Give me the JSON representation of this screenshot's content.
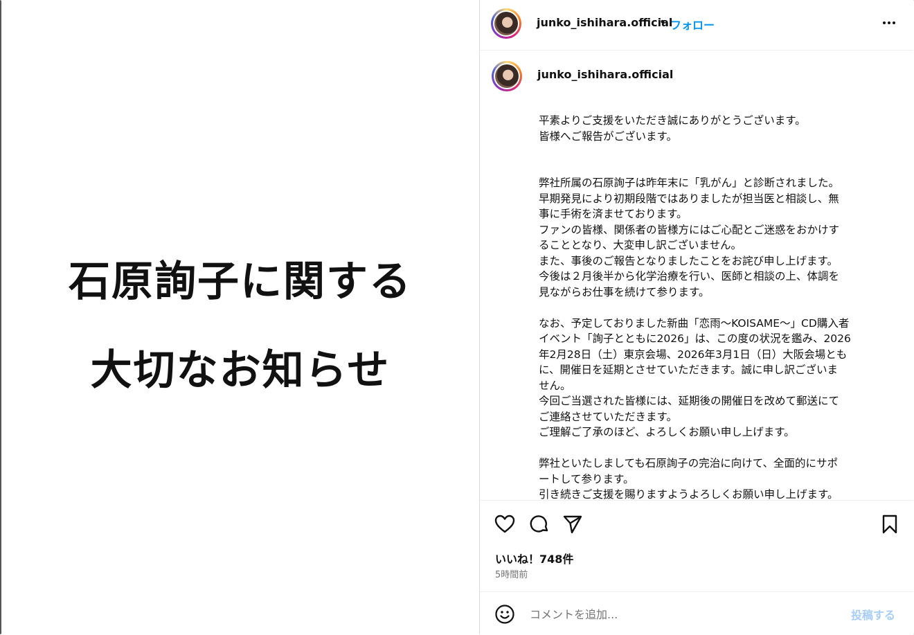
{
  "image": {
    "line1": "石原詢子に関する",
    "line2": "大切なお知らせ"
  },
  "header": {
    "username": "junko_ishihara.official",
    "separator": "•",
    "follow_label": "フォロー",
    "more_icon": "more-horizontal-icon"
  },
  "caption": {
    "username": "junko_ishihara.official",
    "text": "平素よりご支援をいただき誠にありがとうございます。\n皆様へご報告がございます。\n\n\n弊社所属の石原詢子は昨年末に「乳がん」と診断されました。\n早期発見により初期段階ではありましたが担当医と相談し、無\n事に手術を済ませております。\nファンの皆様、関係者の皆様方にはご心配とご迷惑をおかけす\nることとなり、大変申し訳ございません。\nまた、事後のご報告となりましたことをお詫び申し上げます。\n今後は２月後半から化学治療を行い、医師と相談の上、体調を\n見ながらお仕事を続けて参ります。\n\nなお、予定しておりました新曲「恋雨〜KOISAME〜」CD購入者\nイベント「詢子とともに2026」は、この度の状況を鑑み、2026\n年2月28日（土）東京会場、2026年3月1日（日）大阪会場とも\nに、開催日を延期とさせていただきます。誠に申し訳ございま\nせん。\n今回ご当選された皆様には、延期後の開催日を改めて郵送にて\nご連絡させていただきます。\nご理解ご了承のほど、よろしくお願い申し上げます。\n\n弊社といたしましても石原詢子の完治に向けて、全面的にサポ\nートして参ります。\n引き続きご支援を賜りますようよろしくお願い申し上げます。"
  },
  "actions": {
    "icons": [
      "heart-icon",
      "comment-icon",
      "share-icon",
      "bookmark-icon"
    ],
    "likes_label": "いいね！748件",
    "time_label": "5時間前"
  },
  "comment": {
    "placeholder": "コメントを追加...",
    "post_label": "投稿する",
    "post_color": "#a7cdfa"
  },
  "colors": {
    "accent": "#0095f6",
    "muted": "#737373",
    "border": "#dbdbdb"
  }
}
